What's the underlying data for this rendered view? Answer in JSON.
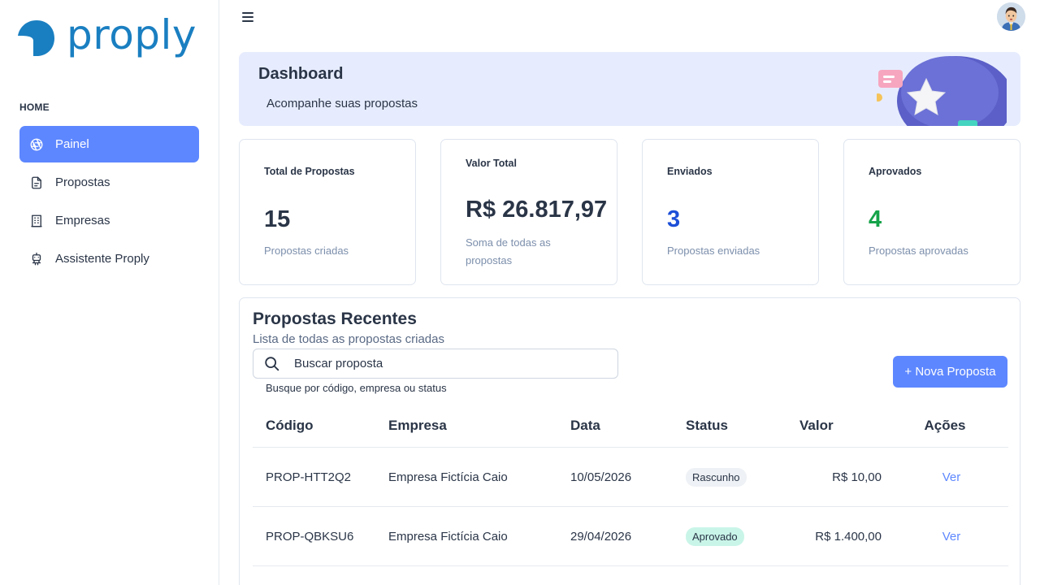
{
  "brand": {
    "name": "proply",
    "color": "#1a7fc1"
  },
  "sidebar": {
    "heading": "HOME",
    "items": [
      {
        "label": "Painel",
        "icon": "aperture-icon",
        "active": true
      },
      {
        "label": "Propostas",
        "icon": "file-icon",
        "active": false
      },
      {
        "label": "Empresas",
        "icon": "building-icon",
        "active": false
      },
      {
        "label": "Assistente Proply",
        "icon": "robot-icon",
        "active": false
      }
    ]
  },
  "banner": {
    "title": "Dashboard",
    "subtitle": "Acompanhe suas propostas"
  },
  "cards": [
    {
      "label": "Total de Propostas",
      "value": "15",
      "note": "Propostas criadas",
      "color": "#2a3547"
    },
    {
      "label": "Valor Total",
      "value": "R$ 26.817,97",
      "note": "Soma de todas as propostas",
      "color": "#2a3547"
    },
    {
      "label": "Enviados",
      "value": "3",
      "note": "Propostas enviadas",
      "color": "#1d4fd8"
    },
    {
      "label": "Aprovados",
      "value": "4",
      "note": "Propostas aprovadas",
      "color": "#16a34a"
    }
  ],
  "recent": {
    "title": "Propostas Recentes",
    "subtitle": "Lista de todas as propostas criadas",
    "search_placeholder": "Buscar proposta",
    "search_hint": "Busque por código, empresa ou status",
    "new_button": "+ Nova Proposta",
    "columns": [
      "Código",
      "Empresa",
      "Data",
      "Status",
      "Valor",
      "Ações"
    ],
    "rows": [
      {
        "code": "PROP-HTT2Q2",
        "company": "Empresa Fictícia Caio",
        "date": "10/05/2026",
        "status": "Rascunho",
        "value": "R$ 10,00",
        "action": "Ver"
      },
      {
        "code": "PROP-QBKSU6",
        "company": "Empresa Fictícia Caio",
        "date": "29/04/2026",
        "status": "Aprovado",
        "value": "R$ 1.400,00",
        "action": "Ver"
      }
    ]
  },
  "colors": {
    "accent": "#5d87ff",
    "banner_bg": "#e6ecfd",
    "approved_badge": "#c9f5e8",
    "draft_badge": "#eef1f5"
  }
}
